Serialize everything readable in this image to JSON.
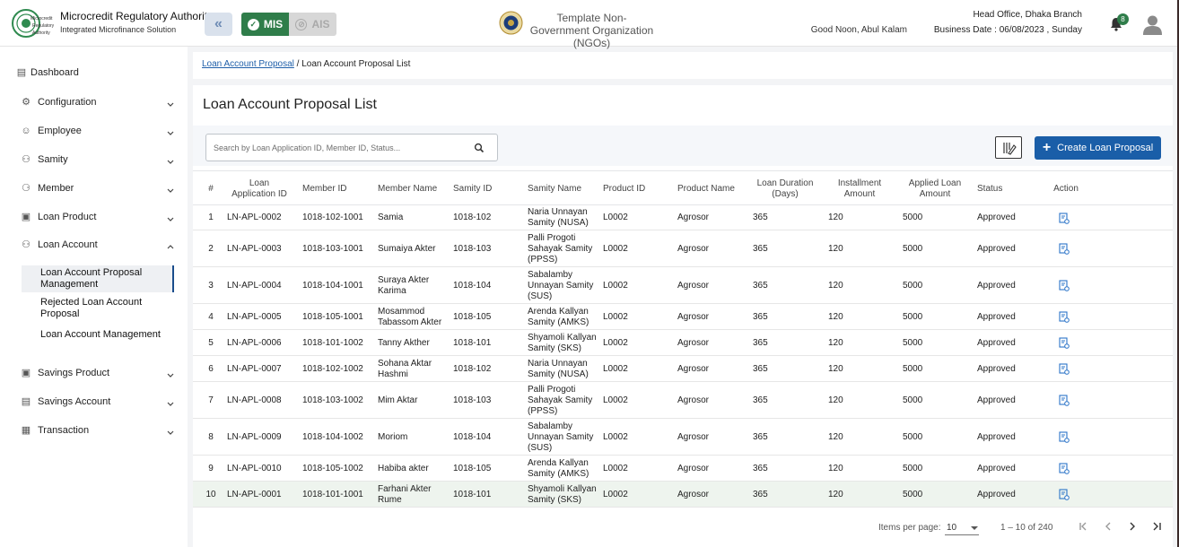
{
  "header": {
    "brand_title": "Microcredit Regulatory Authority",
    "brand_subtitle": "Integrated Microfinance Solution",
    "logo_text": [
      "Microcredit",
      "Regulatory",
      "Authority"
    ],
    "mis_label": "MIS",
    "ais_label": "AIS",
    "org_name": "Template Non-Government Organization (NGOs)",
    "greeting": "Good Noon, Abul Kalam",
    "branch": "Head Office, Dhaka Branch",
    "business_date": "Business Date : 06/08/2023 , Sunday",
    "notification_count": "8"
  },
  "sidebar": {
    "items": [
      {
        "label": "Dashboard",
        "icon": "dashboard-icon",
        "expandable": false
      },
      {
        "label": "Configuration",
        "icon": "config-icon",
        "expandable": true
      },
      {
        "label": "Employee",
        "icon": "employee-icon",
        "expandable": true
      },
      {
        "label": "Samity",
        "icon": "samity-icon",
        "expandable": true
      },
      {
        "label": "Member",
        "icon": "member-icon",
        "expandable": true
      },
      {
        "label": "Loan Product",
        "icon": "loan-product-icon",
        "expandable": true
      },
      {
        "label": "Loan Account",
        "icon": "loan-account-icon",
        "expandable": true,
        "expanded": true
      },
      {
        "label": "Savings Product",
        "icon": "savings-product-icon",
        "expandable": true
      },
      {
        "label": "Savings Account",
        "icon": "savings-account-icon",
        "expandable": true
      },
      {
        "label": "Transaction",
        "icon": "transaction-icon",
        "expandable": true
      }
    ],
    "loan_account_children": [
      {
        "label": "Loan Account Proposal Management",
        "active": true
      },
      {
        "label": "Rejected Loan Account Proposal",
        "active": false
      },
      {
        "label": "Loan Account Management",
        "active": false
      }
    ]
  },
  "breadcrumb": {
    "link": "Loan Account Proposal",
    "separator": "/",
    "current": "Loan Account Proposal List"
  },
  "page": {
    "title": "Loan Account Proposal List",
    "search_placeholder": "Search by Loan Application ID, Member ID, Status...",
    "create_label": "Create Loan Proposal"
  },
  "table": {
    "columns": [
      "#",
      "Loan Application ID",
      "Member ID",
      "Member Name",
      "Samity ID",
      "Samity Name",
      "Product ID",
      "Product Name",
      "Loan Duration (Days)",
      "Installment Amount",
      "Applied Loan Amount",
      "Status",
      "Action"
    ],
    "rows": [
      [
        "1",
        "LN-APL-0002",
        "1018-102-1001",
        "Samia",
        "1018-102",
        "Naria Unnayan Samity (NUSA)",
        "L0002",
        "Agrosor",
        "365",
        "120",
        "5000",
        "Approved"
      ],
      [
        "2",
        "LN-APL-0003",
        "1018-103-1001",
        "Sumaiya Akter",
        "1018-103",
        "Palli Progoti Sahayak Samity (PPSS)",
        "L0002",
        "Agrosor",
        "365",
        "120",
        "5000",
        "Approved"
      ],
      [
        "3",
        "LN-APL-0004",
        "1018-104-1001",
        "Suraya Akter Karima",
        "1018-104",
        "Sabalamby Unnayan Samity (SUS)",
        "L0002",
        "Agrosor",
        "365",
        "120",
        "5000",
        "Approved"
      ],
      [
        "4",
        "LN-APL-0005",
        "1018-105-1001",
        "Mosammod Tabassom Akter",
        "1018-105",
        "Arenda Kallyan Samity (AMKS)",
        "L0002",
        "Agrosor",
        "365",
        "120",
        "5000",
        "Approved"
      ],
      [
        "5",
        "LN-APL-0006",
        "1018-101-1002",
        "Tanny Akther",
        "1018-101",
        "Shyamoli Kallyan Samity (SKS)",
        "L0002",
        "Agrosor",
        "365",
        "120",
        "5000",
        "Approved"
      ],
      [
        "6",
        "LN-APL-0007",
        "1018-102-1002",
        "Sohana Aktar Hashmi",
        "1018-102",
        "Naria Unnayan Samity (NUSA)",
        "L0002",
        "Agrosor",
        "365",
        "120",
        "5000",
        "Approved"
      ],
      [
        "7",
        "LN-APL-0008",
        "1018-103-1002",
        "Mim Aktar",
        "1018-103",
        "Palli Progoti Sahayak Samity (PPSS)",
        "L0002",
        "Agrosor",
        "365",
        "120",
        "5000",
        "Approved"
      ],
      [
        "8",
        "LN-APL-0009",
        "1018-104-1002",
        "Moriom",
        "1018-104",
        "Sabalamby Unnayan Samity (SUS)",
        "L0002",
        "Agrosor",
        "365",
        "120",
        "5000",
        "Approved"
      ],
      [
        "9",
        "LN-APL-0010",
        "1018-105-1002",
        "Habiba akter",
        "1018-105",
        "Arenda Kallyan Samity (AMKS)",
        "L0002",
        "Agrosor",
        "365",
        "120",
        "5000",
        "Approved"
      ],
      [
        "10",
        "LN-APL-0001",
        "1018-101-1001",
        "Farhani Akter Rume",
        "1018-101",
        "Shyamoli Kallyan Samity (SKS)",
        "L0002",
        "Agrosor",
        "365",
        "120",
        "5000",
        "Approved"
      ]
    ]
  },
  "pagination": {
    "items_per_page_label": "Items per page:",
    "items_per_page": "10",
    "range": "1 – 10 of 240"
  },
  "colors": {
    "primary": "#1a5ea8",
    "mis_green": "#2f7d4a",
    "active_border": "#1a4d8c"
  }
}
